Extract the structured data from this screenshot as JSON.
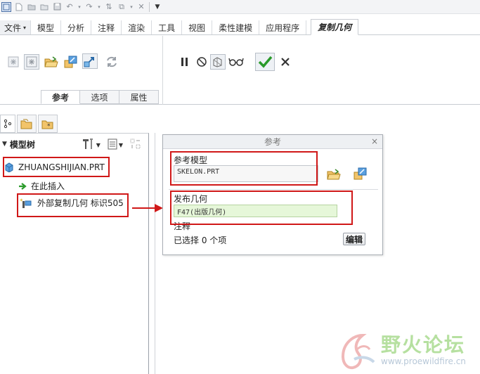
{
  "ribbon_tabs": [
    "文件",
    "模型",
    "分析",
    "注释",
    "渲染",
    "工具",
    "视图",
    "柔性建模",
    "应用程序"
  ],
  "active_tab": "复制几何",
  "subtabs": [
    "参考",
    "选项",
    "属性"
  ],
  "tree": {
    "header": "模型树",
    "root": "ZHUANGSHIJIAN.PRT",
    "insert_here": "在此插入",
    "feature": "外部复制几何 标识505"
  },
  "dialog": {
    "title": "参考",
    "close": "×",
    "ref_model_label": "参考模型",
    "ref_model_value": "SKELON.PRT",
    "publish_label": "发布几何",
    "publish_value": "F47(出版几何)",
    "note_label": "注释",
    "selected_text": "已选择 0 个项",
    "edit_button": "编辑"
  },
  "watermark": {
    "title": "野火论坛",
    "url": "www.proewildfire.cn"
  },
  "colors": {
    "highlight_red": "#d01818",
    "confirm_green": "#2a9a2a",
    "field_green": "#e6f7d9"
  }
}
